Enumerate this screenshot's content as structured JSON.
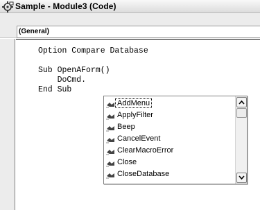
{
  "window": {
    "title": "Sample - Module3 (Code)",
    "icon": "vba-module-icon"
  },
  "object_combo": {
    "value": "(General)"
  },
  "code": {
    "lines": [
      "Option Compare Database",
      "",
      "Sub OpenAForm()",
      "    DoCmd.",
      "End Sub"
    ]
  },
  "autocomplete": {
    "selected_index": 0,
    "item_icon": "method-icon",
    "items": [
      "AddMenu",
      "ApplyFilter",
      "Beep",
      "CancelEvent",
      "ClearMacroError",
      "Close",
      "CloseDatabase"
    ]
  }
}
